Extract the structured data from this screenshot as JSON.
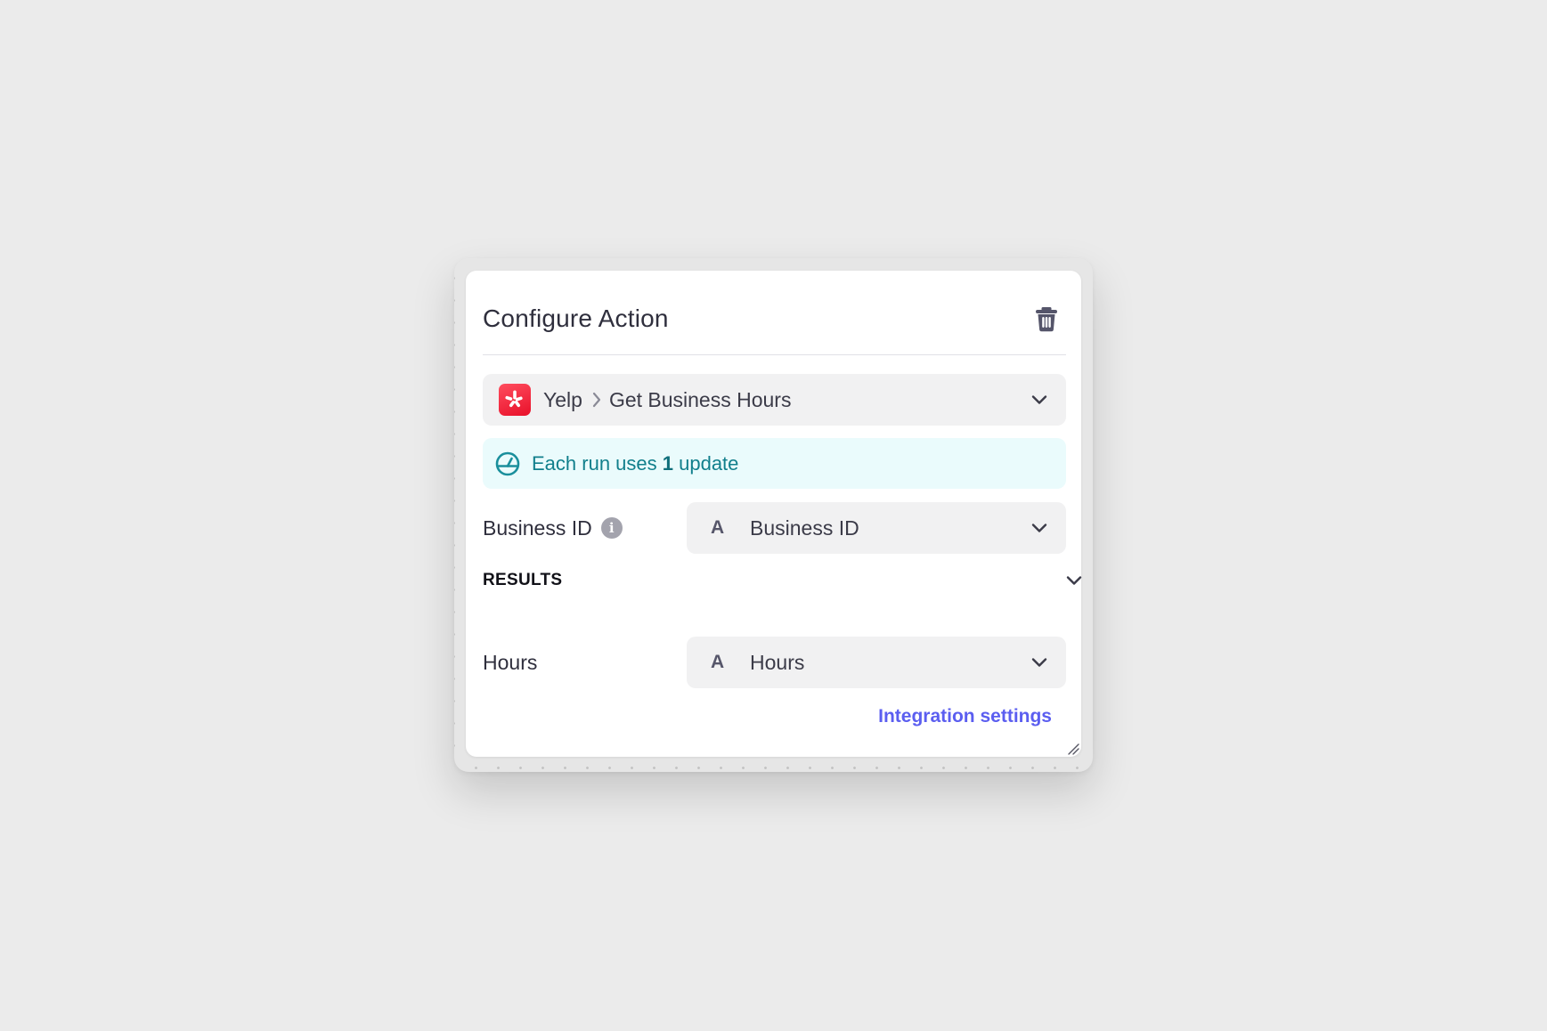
{
  "panel": {
    "title": "Configure Action"
  },
  "action": {
    "app": "Yelp",
    "action": "Get Business Hours"
  },
  "banner": {
    "prefix": "Each run uses ",
    "count": "1",
    "suffix": " update"
  },
  "inputs": {
    "business_id": {
      "label": "Business ID",
      "type_glyph": "A",
      "value": "Business ID"
    }
  },
  "results": {
    "title": "RESULTS",
    "hours": {
      "label": "Hours",
      "type_glyph": "A",
      "value": "Hours"
    }
  },
  "footer": {
    "link": "Integration settings"
  },
  "icons": {
    "trash": "trash-icon",
    "yelp": "yelp-logo-icon",
    "chevron_right": "chevron-right-icon",
    "chevron_down": "chevron-down-icon",
    "gauge": "gauge-icon",
    "info": "info-icon"
  },
  "colors": {
    "accent_link": "#5b5ef0",
    "banner_bg": "#eafbfc",
    "banner_text": "#117f8c",
    "yelp_red": "#e8102a"
  }
}
